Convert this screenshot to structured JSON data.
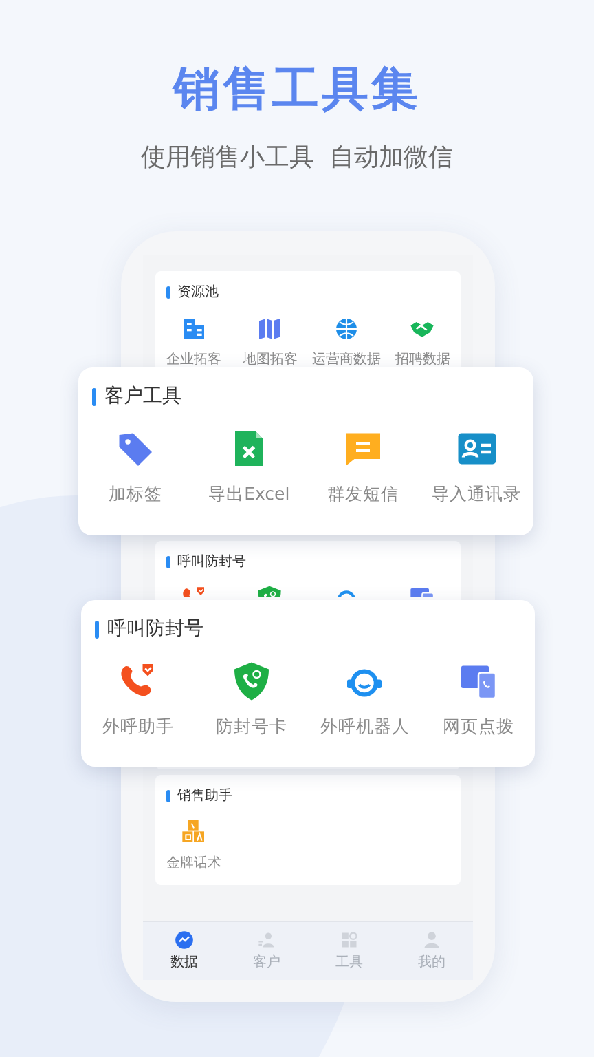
{
  "header": {
    "title": "销售工具集",
    "subtitle": "使用销售小工具  自动加微信"
  },
  "phone": {
    "sections": [
      {
        "title": "资源池",
        "items": [
          {
            "label": "企业拓客"
          },
          {
            "label": "地图拓客"
          },
          {
            "label": "运营商数据"
          },
          {
            "label": "招聘数据"
          }
        ]
      },
      {
        "title": "呼叫防封号"
      },
      {
        "title": "销售助手",
        "items": [
          {
            "label": "金牌话术"
          }
        ]
      }
    ],
    "tabs": [
      {
        "label": "数据",
        "selected": true
      },
      {
        "label": "客户",
        "selected": false
      },
      {
        "label": "工具",
        "selected": false
      },
      {
        "label": "我的",
        "selected": false
      }
    ]
  },
  "popups": [
    {
      "title": "客户工具",
      "items": [
        {
          "label": "加标签"
        },
        {
          "label": "导出Excel"
        },
        {
          "label": "群发短信"
        },
        {
          "label": "导入通讯录"
        }
      ]
    },
    {
      "title": "呼叫防封号",
      "items": [
        {
          "label": "外呼助手"
        },
        {
          "label": "防封号卡"
        },
        {
          "label": "外呼机器人"
        },
        {
          "label": "网页点拨"
        }
      ]
    }
  ]
}
